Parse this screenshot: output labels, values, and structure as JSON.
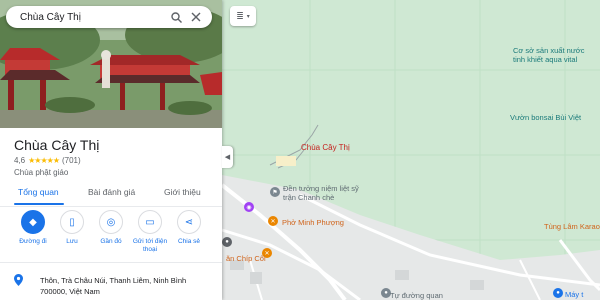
{
  "search": {
    "query": "Chùa Cây Thị"
  },
  "place": {
    "name": "Chùa Cây Thị",
    "rating": "4,6",
    "stars": "★★★★★",
    "reviews": "(701)",
    "category": "Chùa phật giáo"
  },
  "tabs": [
    {
      "label": "Tổng quan"
    },
    {
      "label": "Bài đánh giá"
    },
    {
      "label": "Giới thiệu"
    }
  ],
  "actions": [
    {
      "label": "Đường đi",
      "icon": "directions-icon"
    },
    {
      "label": "Lưu",
      "icon": "bookmark-icon"
    },
    {
      "label": "Gần đó",
      "icon": "nearby-icon"
    },
    {
      "label": "Gửi tới điện thoại",
      "icon": "phone-icon"
    },
    {
      "label": "Chia sẻ",
      "icon": "share-icon"
    }
  ],
  "address": "Thôn, Trà Châu Núi, Thanh Liêm, Ninh Bình 700000, Việt Nam",
  "map": {
    "pin_label": "Chùa Cây Thị",
    "labels": {
      "factory": "Cơ sở sản xuất nước tinh khiết aqua vital",
      "bonsai": "Vườn bonsai Bùi Việt",
      "memorial": "Đền tưởng niệm liệt sỹ trận Chanh chè",
      "pho": "Phở Minh Phượng",
      "karaoke": "Tùng Lâm Karaok",
      "chip": "ăn Chíp Côi",
      "tuduong": "Tự đường quan",
      "mayt": "Máy t"
    }
  }
}
